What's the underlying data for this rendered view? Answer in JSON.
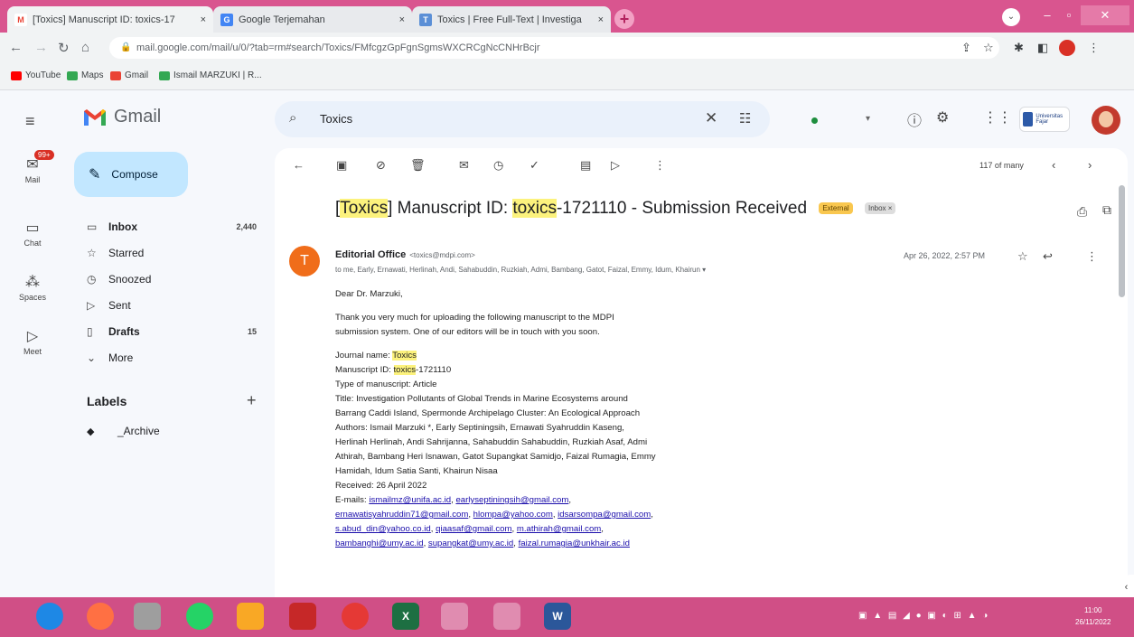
{
  "browser": {
    "tabs": [
      {
        "title": "[Toxics] Manuscript ID: toxics-17",
        "favicon": "M",
        "color": "#ea4335"
      },
      {
        "title": "Google Terjemahan",
        "favicon": "G",
        "color": "#4285f4"
      },
      {
        "title": "Toxics | Free Full-Text | Investiga",
        "favicon": "T",
        "color": "#5b8fd6"
      }
    ],
    "tab_close": "×",
    "new_tab": "+",
    "url": "mail.google.com/mail/u/0/?tab=rm#search/Toxics/FMfcgzGpFgnSgmsWXCRCgNcCNHrBcjr",
    "bookmarks": [
      {
        "label": "YouTube",
        "color": "#ff0000"
      },
      {
        "label": "Maps",
        "color": "#34a853"
      },
      {
        "label": "Gmail",
        "color": "#ea4335"
      },
      {
        "label": "Ismail MARZUKI | R...",
        "color": "#34a853"
      }
    ]
  },
  "gmail": {
    "app_name": "Gmail",
    "rail": [
      {
        "label": "Mail",
        "icon": "mail-icon",
        "badge": "99+"
      },
      {
        "label": "Chat",
        "icon": "chat-icon"
      },
      {
        "label": "Spaces",
        "icon": "spaces-icon"
      },
      {
        "label": "Meet",
        "icon": "meet-icon"
      }
    ],
    "compose_label": "Compose",
    "nav": [
      {
        "label": "Inbox",
        "count": "2,440",
        "icon": "inbox-icon",
        "bold": true
      },
      {
        "label": "Starred",
        "count": "",
        "icon": "star-icon",
        "bold": false
      },
      {
        "label": "Snoozed",
        "count": "",
        "icon": "clock-icon",
        "bold": false
      },
      {
        "label": "Sent",
        "count": "",
        "icon": "send-icon",
        "bold": false
      },
      {
        "label": "Drafts",
        "count": "15",
        "icon": "draft-icon",
        "bold": true
      },
      {
        "label": "More",
        "count": "",
        "icon": "chevron-down-icon",
        "bold": false
      }
    ],
    "labels_heading": "Labels",
    "labels": [
      {
        "label": "_Archive"
      }
    ],
    "search": {
      "value": "Toxics"
    },
    "pager": "117 of many",
    "org_name": "Universitas Fajar",
    "message": {
      "subject_prefix": "[",
      "subject_hl1": "Toxics",
      "subject_mid": "] Manuscript ID: ",
      "subject_hl2": "toxics",
      "subject_rest": "-1721110 - Submission Received",
      "chip_external": "External",
      "chip_inbox": "Inbox ×",
      "avatar_letter": "T",
      "from_name": "Editorial Office",
      "from_email": "<toxics@mdpi.com>",
      "to": "to me, Early, Ernawati, Herlinah, Andi, Sahabuddin, Ruzkiah, Admi, Bambang, Gatot, Faizal, Emmy, Idum, Khairun ▾",
      "date": "Apr 26, 2022, 2:57 PM",
      "greeting": "Dear Dr. Marzuki,",
      "para1_l1": "Thank you very much for uploading the following manuscript to the MDPI",
      "para1_l2": "submission system. One of our editors will be in touch with you soon.",
      "journal_label": "Journal name: ",
      "journal_value": "Toxics",
      "msid_label": "Manuscript ID: ",
      "msid_hl": "toxics",
      "msid_rest": "-1721110",
      "type": "Type of manuscript: Article",
      "title_l1": "Title: Investigation Pollutants of Global Trends in Marine Ecosystems around",
      "title_l2": "Barrang Caddi Island, Spermonde Archipelago Cluster: An Ecological Approach",
      "authors_l1": "Authors: Ismail Marzuki *, Early Septiningsih, Ernawati Syahruddin Kaseng,",
      "authors_l2": "Herlinah Herlinah, Andi Sahrijanna, Sahabuddin Sahabuddin, Ruzkiah Asaf, Admi",
      "authors_l3": "Athirah, Bambang Heri Isnawan, Gatot Supangkat Samidjo, Faizal Rumagia, Emmy",
      "authors_l4": "Hamidah, Idum Satia Santi, Khairun Nisaa",
      "received": "Received: 26 April 2022",
      "emails_label": "E-mails: ",
      "emails": [
        "ismailmz@unifa.ac.id",
        "earlyseptiningsih@gmail.com",
        "ernawatisyahruddin71@gmail.com",
        "hlompa@yahoo.com",
        "idsarsompa@gmail.com",
        "s.abud_din@yahoo.co.id",
        "qiaasaf@gmail.com",
        "m.athirah@gmail.com",
        "bambanghi@umy.ac.id",
        "supangkat@umy.ac.id",
        "faizal.rumagia@unkhair.ac.id"
      ]
    }
  },
  "taskbar": {
    "apps": [
      {
        "label": "",
        "color": "#1e88e5"
      },
      {
        "label": "",
        "color": "#ff7043"
      },
      {
        "label": "",
        "color": "#9e9e9e"
      },
      {
        "label": "",
        "color": "#25d366"
      },
      {
        "label": "",
        "color": "#f9a825"
      },
      {
        "label": "",
        "color": "#c62828"
      },
      {
        "label": "",
        "color": "#e53935"
      },
      {
        "label": "X",
        "color": "#1d6f42"
      },
      {
        "label": "",
        "color": "#4285f4"
      },
      {
        "label": "",
        "color": "#4285f4"
      },
      {
        "label": "W",
        "color": "#2b579a"
      }
    ],
    "time": "11:00",
    "date": "26/11/2022"
  }
}
